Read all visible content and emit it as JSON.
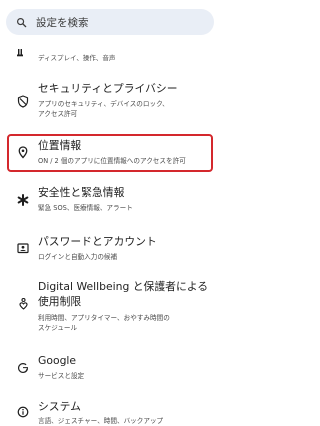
{
  "search": {
    "placeholder": "設定を検索"
  },
  "items": [
    {
      "icon": "display-icon",
      "title": "",
      "subtitle": "ディスプレイ、操作、音声"
    },
    {
      "icon": "shield-icon",
      "title": "セキュリティとプライバシー",
      "subtitle_lines": [
        "アプリのセキュリティ、デバイスのロック、",
        "アクセス許可"
      ]
    },
    {
      "icon": "location-pin-icon",
      "title": "位置情報",
      "subtitle": "ON / 2 個のアプリに位置情報へのアクセスを許可",
      "highlighted": true
    },
    {
      "icon": "asterisk-icon",
      "title": "安全性と緊急情報",
      "subtitle": "緊急 SOS、医療情報、アラート"
    },
    {
      "icon": "password-icon",
      "title": "パスワードとアカウント",
      "subtitle": "ログインと自動入力の候補"
    },
    {
      "icon": "wellbeing-icon",
      "title_lines": [
        "Digital Wellbeing と保護者による",
        "使用制限"
      ],
      "subtitle_lines": [
        "利用時間、アプリタイマー、おやすみ時間の",
        "スケジュール"
      ]
    },
    {
      "icon": "google-icon",
      "title": "Google",
      "subtitle": "サービスと設定"
    },
    {
      "icon": "info-icon",
      "title": "システム",
      "subtitle": "言語、ジェスチャー、時間、バックアップ"
    }
  ],
  "colors": {
    "search_bg": "#e9eef6",
    "highlight": "#d4282d",
    "text": "#1f1f1f",
    "subtext": "#4a4a4a"
  }
}
